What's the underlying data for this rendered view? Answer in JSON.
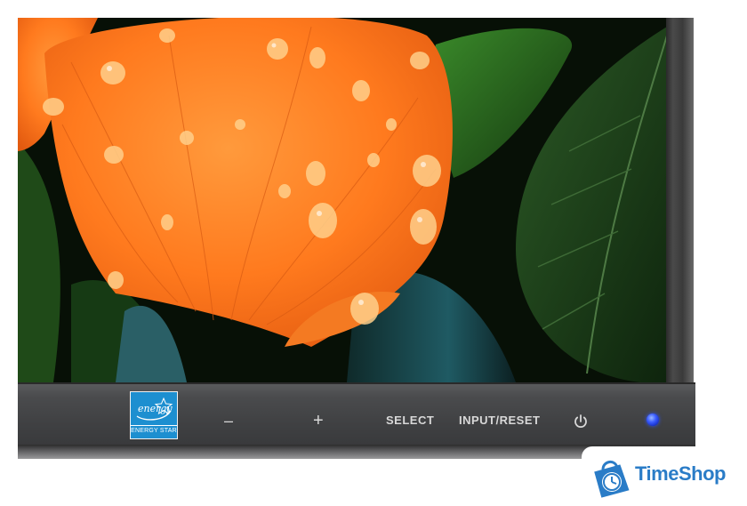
{
  "monitor": {
    "energy_star": {
      "script_text": "energy",
      "label": "ENERGY STAR",
      "color": "#1d8fd0"
    },
    "buttons": {
      "minus": "–",
      "plus": "+",
      "select": "SELECT",
      "input_reset": "INPUT/RESET"
    },
    "power_icon": "power-icon",
    "led_color": "#2f55ff"
  },
  "watermark": {
    "brand": "TimeShop",
    "color": "#2a7cc7"
  }
}
